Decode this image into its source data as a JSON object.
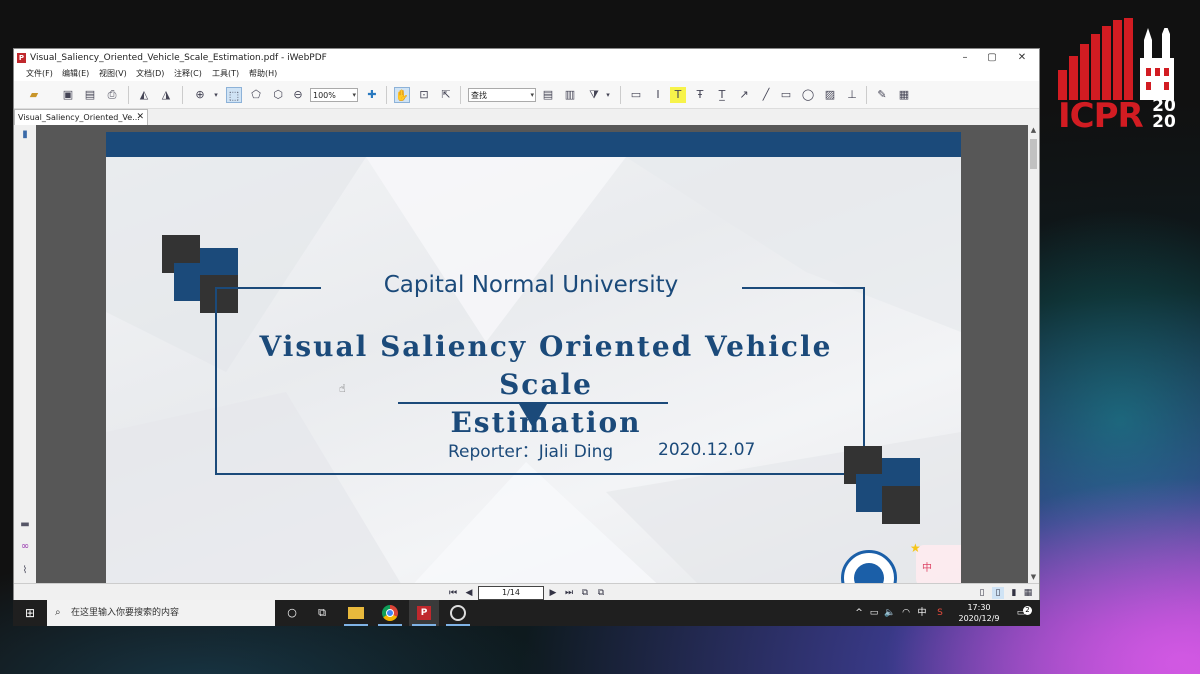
{
  "window": {
    "title": "Visual_Saliency_Oriented_Vehicle_Scale_Estimation.pdf - iWebPDF",
    "minimize": "–",
    "maximize": "▢",
    "close": "✕"
  },
  "menu": [
    "文件(F)",
    "编辑(E)",
    "视图(V)",
    "文档(D)",
    "注释(C)",
    "工具(T)",
    "帮助(H)"
  ],
  "toolbar": {
    "zoom_value": "100%",
    "find_placeholder": "查找"
  },
  "tab": {
    "label": "Visual_Saliency_Oriented_Ve...",
    "close": "✕"
  },
  "slide": {
    "university": "Capital Normal University",
    "title_line1": "Visual Saliency Oriented Vehicle Scale",
    "title_line2": "Estimation",
    "reporter": "Reporter：Jiali Ding",
    "date": "2020.12.07",
    "sticker_text": "中"
  },
  "navigation": {
    "page": "1/14"
  },
  "taskbar": {
    "search_placeholder": "在这里输入你要搜索的内容",
    "tray_ime": "中",
    "time": "17:30",
    "date": "2020/12/9",
    "notification_count": "2"
  },
  "logo": {
    "text": "ICPR",
    "year_top": "20",
    "year_bottom": "20"
  },
  "colors": {
    "slide_blue": "#1b4a7a",
    "square_dark": "#333333",
    "square_blue": "#1b4a7a",
    "logo_red": "#d21c22"
  }
}
